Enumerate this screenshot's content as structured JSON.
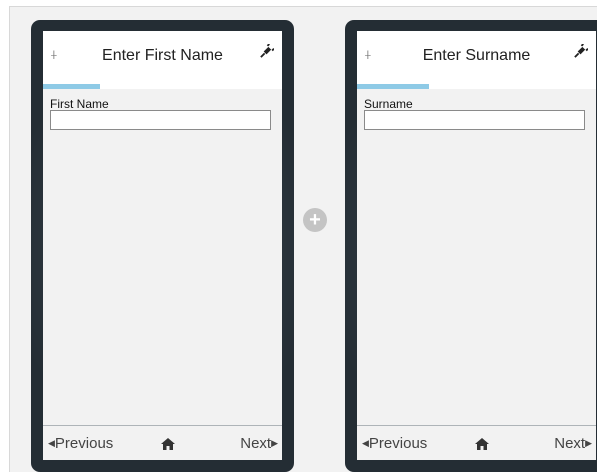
{
  "pages": [
    {
      "title": "Enter First Name",
      "field_label": "First Name",
      "field_value": "",
      "progress": 0.24,
      "prev_label": "Previous",
      "next_label": "Next",
      "pin_icon": "pin-icon",
      "plug_icon": "plug-icon",
      "home_icon": "home-icon"
    },
    {
      "title": "Enter Surname",
      "field_label": "Surname",
      "field_value": "",
      "progress": 0.3,
      "prev_label": "Previous",
      "next_label": "Next",
      "pin_icon": "pin-icon",
      "plug_icon": "plug-icon",
      "home_icon": "home-icon"
    }
  ],
  "add_button_icon": "plus-circle-icon",
  "colors": {
    "progress": "#8ecae6",
    "device_frame": "#2b343b",
    "canvas": "#f2f2f2"
  }
}
